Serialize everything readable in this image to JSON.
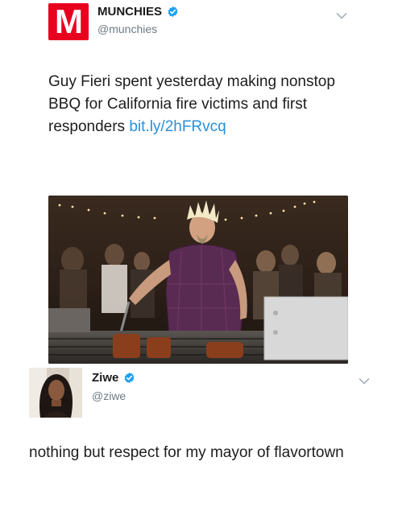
{
  "tweet1": {
    "display_name": "MUNCHIES",
    "handle": "@munchies",
    "logo_letter": "M",
    "logo_color": "#e8001f",
    "verified_icon": "verified-badge-icon",
    "menu_icon": "chevron-down-icon",
    "text": "Guy Fieri spent yesterday making nonstop BBQ for California fire victims and first responders ",
    "link_text": "bit.ly/2hFRvcq",
    "link_color": "#2a8fd8"
  },
  "tweet2": {
    "display_name": "Ziwe",
    "handle": "@ziwe",
    "verified_icon": "verified-badge-icon",
    "menu_icon": "chevron-down-icon",
    "text": "nothing but respect for my mayor of flavortown"
  }
}
